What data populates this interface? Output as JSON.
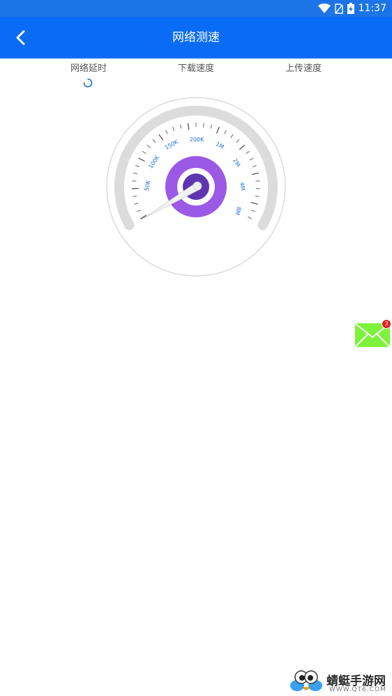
{
  "status_bar": {
    "time": "11:37",
    "icons": [
      "wifi-icon",
      "no-sim-icon",
      "battery-charging-icon"
    ]
  },
  "app_bar": {
    "title": "网络测速",
    "back_icon": "chevron-left-icon"
  },
  "metrics": [
    {
      "label": "网络延时",
      "state": "loading"
    },
    {
      "label": "下载速度"
    },
    {
      "label": "上传速度"
    }
  ],
  "gauge": {
    "scale_labels": [
      "50K",
      "100K",
      "150K",
      "200K",
      "1M",
      "2M",
      "4M",
      "8M"
    ],
    "value": 0,
    "colors": {
      "arc": "#dcdcdc",
      "hub_outer": "#9b59e6",
      "hub_inner": "#5e35b1",
      "label": "#1a6fd6"
    }
  },
  "mail": {
    "icon": "mail-icon",
    "badge": "3",
    "color": "#7cf23a"
  },
  "watermark": {
    "name": "蜻蜓手游网",
    "url": "WWW.QT6.COM"
  },
  "colors": {
    "status_bar": "#1d74e6",
    "app_bar": "#0a6cf5"
  }
}
